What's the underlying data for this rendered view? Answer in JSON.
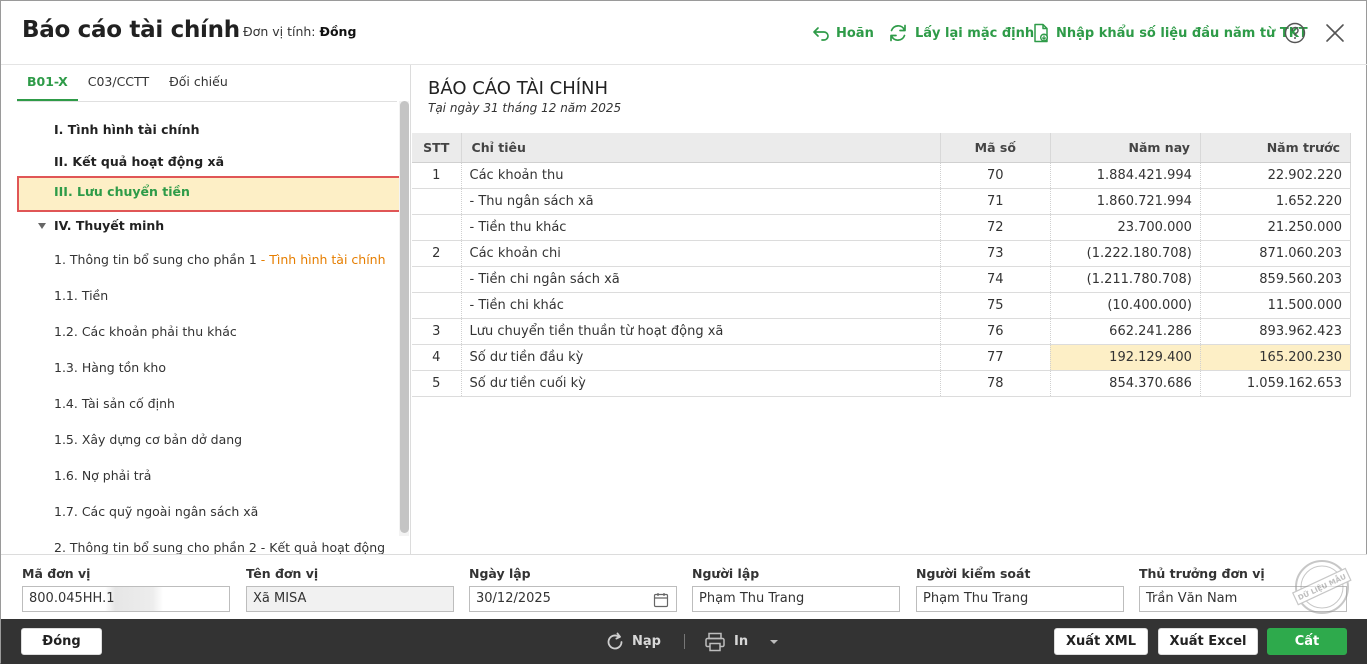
{
  "header": {
    "title": "Báo cáo tài chính",
    "unit_label": "Đơn vị tính:",
    "unit_value": "Đồng",
    "undo_label": "Hoãn",
    "reset_label": "Lấy lại mặc định",
    "import_label": "Nhập khẩu số liệu đầu năm từ TKT"
  },
  "tabs": [
    {
      "label": "B01-X"
    },
    {
      "label": "C03/CCTT"
    },
    {
      "label": "Đối chiếu"
    }
  ],
  "tree": [
    {
      "label": "I. Tình hình tài chính"
    },
    {
      "label": "II. Kết quả hoạt động xã"
    },
    {
      "label": "III. Lưu chuyển tiền"
    },
    {
      "label": "IV. Thuyết minh"
    },
    {
      "label": "1. Thông tin bổ sung cho phần 1 ",
      "suffix": "- Tình hình tài chính"
    },
    {
      "label": "1.1. Tiền"
    },
    {
      "label": "1.2. Các khoản phải thu khác"
    },
    {
      "label": "1.3. Hàng tồn kho"
    },
    {
      "label": "1.4. Tài sản cố định"
    },
    {
      "label": "1.5. Xây dựng cơ bản dở dang"
    },
    {
      "label": "1.6. Nợ phải trả"
    },
    {
      "label": "1.7. Các quỹ ngoài ngân sách xã"
    },
    {
      "label": "2. Thông tin bổ sung cho phần 2 - Kết quả hoạt động"
    }
  ],
  "report": {
    "title": "BÁO CÁO TÀI CHÍNH",
    "date": "Tại ngày 31 tháng 12 năm 2025",
    "columns": [
      "STT",
      "Chỉ tiêu",
      "Mã số",
      "Năm nay",
      "Năm trước"
    ],
    "rows": [
      {
        "stt": "1",
        "name": "Các khoản thu",
        "code": "70",
        "cur": "1.884.421.994",
        "prev": "22.902.220"
      },
      {
        "stt": "",
        "name": "- Thu ngân sách xã",
        "code": "71",
        "cur": "1.860.721.994",
        "prev": "1.652.220"
      },
      {
        "stt": "",
        "name": "- Tiền thu khác",
        "code": "72",
        "cur": "23.700.000",
        "prev": "21.250.000"
      },
      {
        "stt": "2",
        "name": "Các khoản chi",
        "code": "73",
        "cur": "(1.222.180.708)",
        "prev": "871.060.203"
      },
      {
        "stt": "",
        "name": "- Tiền chi ngân sách xã",
        "code": "74",
        "cur": "(1.211.780.708)",
        "prev": "859.560.203"
      },
      {
        "stt": "",
        "name": "- Tiền chi khác",
        "code": "75",
        "cur": "(10.400.000)",
        "prev": "11.500.000"
      },
      {
        "stt": "3",
        "name": "Lưu chuyển tiền thuần từ hoạt động xã",
        "code": "76",
        "cur": "662.241.286",
        "prev": "893.962.423"
      },
      {
        "stt": "4",
        "name": "Số dư tiền đầu kỳ",
        "code": "77",
        "cur": "192.129.400",
        "prev": "165.200.230"
      },
      {
        "stt": "5",
        "name": "Số dư tiền cuối kỳ",
        "code": "78",
        "cur": "854.370.686",
        "prev": "1.059.162.653"
      }
    ]
  },
  "form": {
    "unit_code_label": "Mã đơn vị",
    "unit_code_value": "800.045HH.1",
    "unit_name_label": "Tên đơn vị",
    "unit_name_value": "Xã MISA",
    "date_label": "Ngày lập",
    "date_value": "30/12/2025",
    "preparer_label": "Người lập",
    "preparer_value": "Phạm Thu Trang",
    "controller_label": "Người kiểm soát",
    "controller_value": "Phạm Thu Trang",
    "head_label": "Thủ trưởng đơn vị",
    "head_value": "Trần Văn Nam"
  },
  "stamp_text": "DỮ LIỆU MẪU",
  "bottom": {
    "close_label": "Đóng",
    "reload_label": "Nạp",
    "print_label": "In",
    "xml_label": "Xuất XML",
    "excel_label": "Xuất Excel",
    "save_label": "Cất"
  },
  "colors": {
    "accent": "#2e9b48",
    "highlight_cell": "#fdefc6",
    "selected_border": "#e05656",
    "bottom_bar": "#333333"
  }
}
